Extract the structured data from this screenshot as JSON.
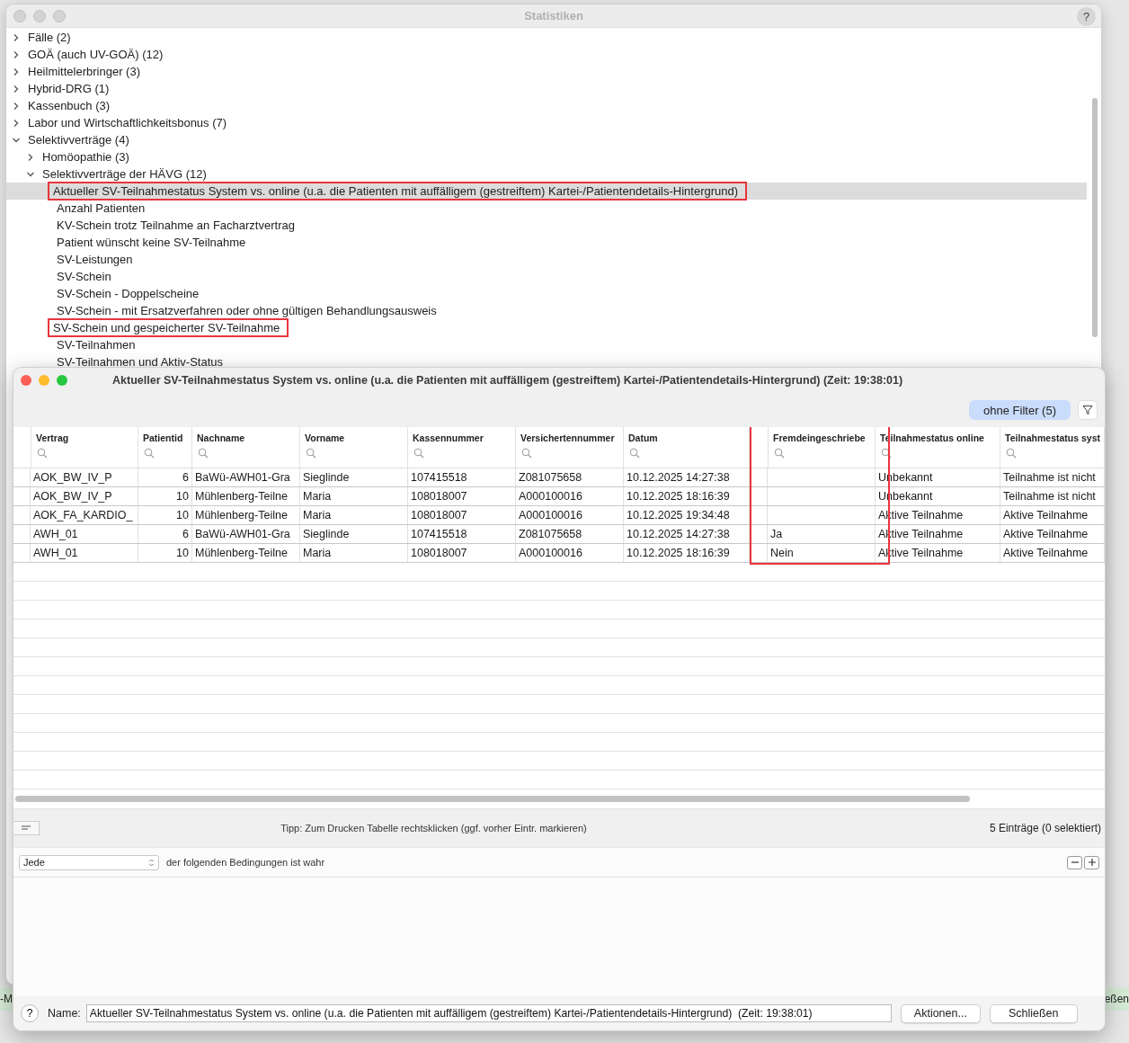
{
  "background": {
    "fragments": [
      "-M",
      "eßen"
    ]
  },
  "statistics_window": {
    "title": "Statistiken",
    "help": "?",
    "tree": [
      {
        "label": "Fälle (2)",
        "expanded": false,
        "selected": false,
        "annotated": false
      },
      {
        "label": "GOÄ (auch UV-GOÄ) (12)",
        "expanded": false,
        "selected": false,
        "annotated": false
      },
      {
        "label": "Heilmittelerbringer (3)",
        "expanded": false,
        "selected": false,
        "annotated": false
      },
      {
        "label": "Hybrid-DRG (1)",
        "expanded": false,
        "selected": false,
        "annotated": false
      },
      {
        "label": "Kassenbuch (3)",
        "expanded": false,
        "selected": false,
        "annotated": false
      },
      {
        "label": "Labor und Wirtschaftlichkeitsbonus (7)",
        "expanded": false,
        "selected": false,
        "annotated": false
      },
      {
        "label": "Selektivverträge (4)",
        "expanded": true,
        "selected": false,
        "annotated": false,
        "children": [
          {
            "label": "Homöopathie (3)",
            "expanded": false,
            "selected": false,
            "annotated": false
          },
          {
            "label": "Selektivverträge der HÄVG (12)",
            "expanded": true,
            "selected": false,
            "annotated": false,
            "children": [
              {
                "label": "Aktueller SV-Teilnahmestatus System vs. online (u.a. die Patienten mit auffälligem (gestreiftem) Kartei-/Patientendetails-Hintergrund)",
                "selected": true,
                "annotated": true
              },
              {
                "label": "Anzahl Patienten",
                "selected": false,
                "annotated": false
              },
              {
                "label": "KV-Schein trotz Teilnahme an Facharztvertrag",
                "selected": false,
                "annotated": false
              },
              {
                "label": "Patient wünscht keine SV-Teilnahme",
                "selected": false,
                "annotated": false
              },
              {
                "label": "SV-Leistungen",
                "selected": false,
                "annotated": false
              },
              {
                "label": "SV-Schein",
                "selected": false,
                "annotated": false
              },
              {
                "label": "SV-Schein - Doppelscheine",
                "selected": false,
                "annotated": false
              },
              {
                "label": "SV-Schein - mit Ersatzverfahren oder ohne gültigen Behandlungsausweis",
                "selected": false,
                "annotated": false
              },
              {
                "label": "SV-Schein und gespeicherter SV-Teilnahme",
                "selected": false,
                "annotated": true
              },
              {
                "label": "SV-Teilnahmen",
                "selected": false,
                "annotated": false
              },
              {
                "label": "SV-Teilnahmen und Aktiv-Status",
                "selected": false,
                "annotated": false
              }
            ]
          }
        ]
      }
    ]
  },
  "report_window": {
    "title": "Aktueller SV-Teilnahmestatus System vs. online (u.a. die Patienten mit auffälligem (gestreiftem) Kartei-/Patientendetails-Hintergrund)  (Zeit: 19:38:01)",
    "filter_button": "ohne Filter (5)",
    "columns": [
      {
        "kind": "spacer"
      },
      {
        "kind": "data",
        "label": "Vertrag",
        "numeric": false,
        "annotated": false
      },
      {
        "kind": "data",
        "label": "Patientid",
        "numeric": true,
        "annotated": false
      },
      {
        "kind": "data",
        "label": "Nachname",
        "numeric": false,
        "annotated": false
      },
      {
        "kind": "data",
        "label": "Vorname",
        "numeric": false,
        "annotated": false
      },
      {
        "kind": "data",
        "label": "Kassennummer",
        "numeric": false,
        "annotated": false
      },
      {
        "kind": "data",
        "label": "Versichertennummer",
        "numeric": false,
        "annotated": false
      },
      {
        "kind": "data",
        "label": "Datum",
        "numeric": false,
        "annotated": false
      },
      {
        "kind": "spacer"
      },
      {
        "kind": "data",
        "label": "Fremdeingeschriebe",
        "numeric": false,
        "annotated": true
      },
      {
        "kind": "data",
        "label": "Teilnahmestatus online",
        "numeric": false,
        "annotated": false
      },
      {
        "kind": "data",
        "label": "Teilnahmestatus syst",
        "numeric": false,
        "annotated": false
      }
    ],
    "rows": [
      {
        "cells": [
          "",
          "AOK_BW_IV_P",
          "6",
          "BaWü-AWH01-Gra",
          "Sieglinde",
          "107415518",
          "Z081075658",
          "10.12.2025 14:27:38",
          "",
          "",
          "Unbekannt",
          "Teilnahme ist nicht"
        ]
      },
      {
        "cells": [
          "",
          "AOK_BW_IV_P",
          "10",
          "Mühlenberg-Teilne",
          "Maria",
          "108018007",
          "A000100016",
          "10.12.2025 18:16:39",
          "",
          "",
          "Unbekannt",
          "Teilnahme ist nicht"
        ]
      },
      {
        "cells": [
          "",
          "AOK_FA_KARDIO_",
          "10",
          "Mühlenberg-Teilne",
          "Maria",
          "108018007",
          "A000100016",
          "10.12.2025 19:34:48",
          "",
          "",
          "Aktive Teilnahme",
          "Aktive Teilnahme"
        ]
      },
      {
        "cells": [
          "",
          "AWH_01",
          "6",
          "BaWü-AWH01-Gra",
          "Sieglinde",
          "107415518",
          "Z081075658",
          "10.12.2025 14:27:38",
          "",
          "Ja",
          "Aktive Teilnahme",
          "Aktive Teilnahme"
        ]
      },
      {
        "cells": [
          "",
          "AWH_01",
          "10",
          "Mühlenberg-Teilne",
          "Maria",
          "108018007",
          "A000100016",
          "10.12.2025 18:16:39",
          "",
          "Nein",
          "Aktive Teilnahme",
          "Aktive Teilnahme"
        ]
      }
    ],
    "tip": "Tipp: Zum Drucken Tabelle rechtsklicken (ggf. vorher Eintr. markieren)",
    "count": "5 Einträge (0 selektiert)",
    "condition": {
      "match": "Jede",
      "text": "der folgenden Bedingungen ist wahr"
    },
    "help": "?",
    "name_label": "Name:",
    "name_value": "Aktueller SV-Teilnahmestatus System vs. online (u.a. die Patienten mit auffälligem (gestreiftem) Kartei-/Patientendetails-Hintergrund)  (Zeit: 19:38:01)",
    "buttons": [
      "Aktionen...",
      "Schließen"
    ]
  }
}
